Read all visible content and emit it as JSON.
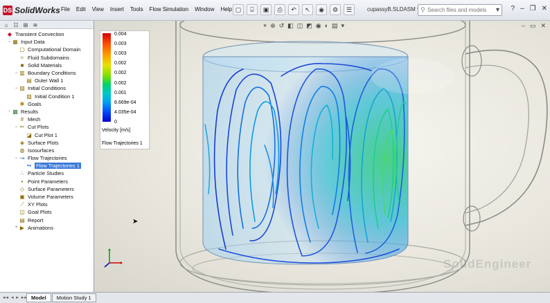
{
  "app": {
    "logo_mark": "DS",
    "logo_text": "SolidWorks",
    "menu": [
      "File",
      "Edit",
      "View",
      "Insert",
      "Tools",
      "Flow Simulation",
      "Window",
      "Help"
    ],
    "doc_title": "cupassyB.SLDASM *",
    "search_placeholder": "Search files and models"
  },
  "left_panel": {
    "tree": [
      {
        "label": "Transient Convection",
        "level": 0,
        "exp": "",
        "icon": "flow-project-icon"
      },
      {
        "label": "Input Data",
        "level": 1,
        "exp": "−",
        "icon": "input-data-icon"
      },
      {
        "label": "Computational Domain",
        "level": 2,
        "exp": "",
        "icon": "domain-icon"
      },
      {
        "label": "Fluid Subdomains",
        "level": 2,
        "exp": "",
        "icon": "fluid-icon"
      },
      {
        "label": "Solid Materials",
        "level": 2,
        "exp": "",
        "icon": "solid-icon"
      },
      {
        "label": "Boundary Conditions",
        "level": 2,
        "exp": "−",
        "icon": "boundary-icon"
      },
      {
        "label": "Outer Wall 1",
        "level": 3,
        "exp": "",
        "icon": "wall-icon"
      },
      {
        "label": "Initial Conditions",
        "level": 2,
        "exp": "−",
        "icon": "initial-icon"
      },
      {
        "label": "Initial Condition 1",
        "level": 3,
        "exp": "",
        "icon": "condition-icon"
      },
      {
        "label": "Goals",
        "level": 2,
        "exp": "",
        "icon": "goals-icon"
      },
      {
        "label": "Results",
        "level": 1,
        "exp": "−",
        "icon": "results-icon"
      },
      {
        "label": "Mesh",
        "level": 2,
        "exp": "",
        "icon": "mesh-icon"
      },
      {
        "label": "Cut Plots",
        "level": 2,
        "exp": "−",
        "icon": "cut-plots-icon"
      },
      {
        "label": "Cut Plot 1",
        "level": 3,
        "exp": "",
        "icon": "cut-plot-icon"
      },
      {
        "label": "Surface Plots",
        "level": 2,
        "exp": "",
        "icon": "surface-plots-icon"
      },
      {
        "label": "Isosurfaces",
        "level": 2,
        "exp": "",
        "icon": "isosurfaces-icon"
      },
      {
        "label": "Flow Trajectories",
        "level": 2,
        "exp": "−",
        "icon": "trajectories-icon"
      },
      {
        "label": "Flow Trajectories 1",
        "level": 3,
        "exp": "",
        "icon": "trajectory-icon",
        "selected": true
      },
      {
        "label": "Particle Studies",
        "level": 2,
        "exp": "",
        "icon": "particle-icon"
      },
      {
        "label": "Point Parameters",
        "level": 2,
        "exp": "",
        "icon": "point-params-icon"
      },
      {
        "label": "Surface Parameters",
        "level": 2,
        "exp": "",
        "icon": "surface-params-icon"
      },
      {
        "label": "Volume Parameters",
        "level": 2,
        "exp": "",
        "icon": "volume-params-icon"
      },
      {
        "label": "XY Plots",
        "level": 2,
        "exp": "",
        "icon": "xy-plots-icon"
      },
      {
        "label": "Goal Plots",
        "level": 2,
        "exp": "",
        "icon": "goal-plots-icon"
      },
      {
        "label": "Report",
        "level": 2,
        "exp": "",
        "icon": "report-icon"
      },
      {
        "label": "Animations",
        "level": 2,
        "exp": "+",
        "icon": "animations-icon"
      }
    ]
  },
  "viewport": {
    "legend": {
      "ticks": [
        "0.004",
        "0.003",
        "0.003",
        "0.002",
        "0.002",
        "0.002",
        "0.001",
        "8.669e-04",
        "4.035e-04",
        "0"
      ],
      "units": "Velocity [m/s]",
      "title": "Flow Trajectories 1"
    },
    "watermark": "SolidEngineer"
  },
  "bottom": {
    "tabs": [
      "Model",
      "Motion Study 1"
    ],
    "active": "Model"
  },
  "colors": {
    "selection": "#3a79d8",
    "accent": "#c8102e"
  }
}
